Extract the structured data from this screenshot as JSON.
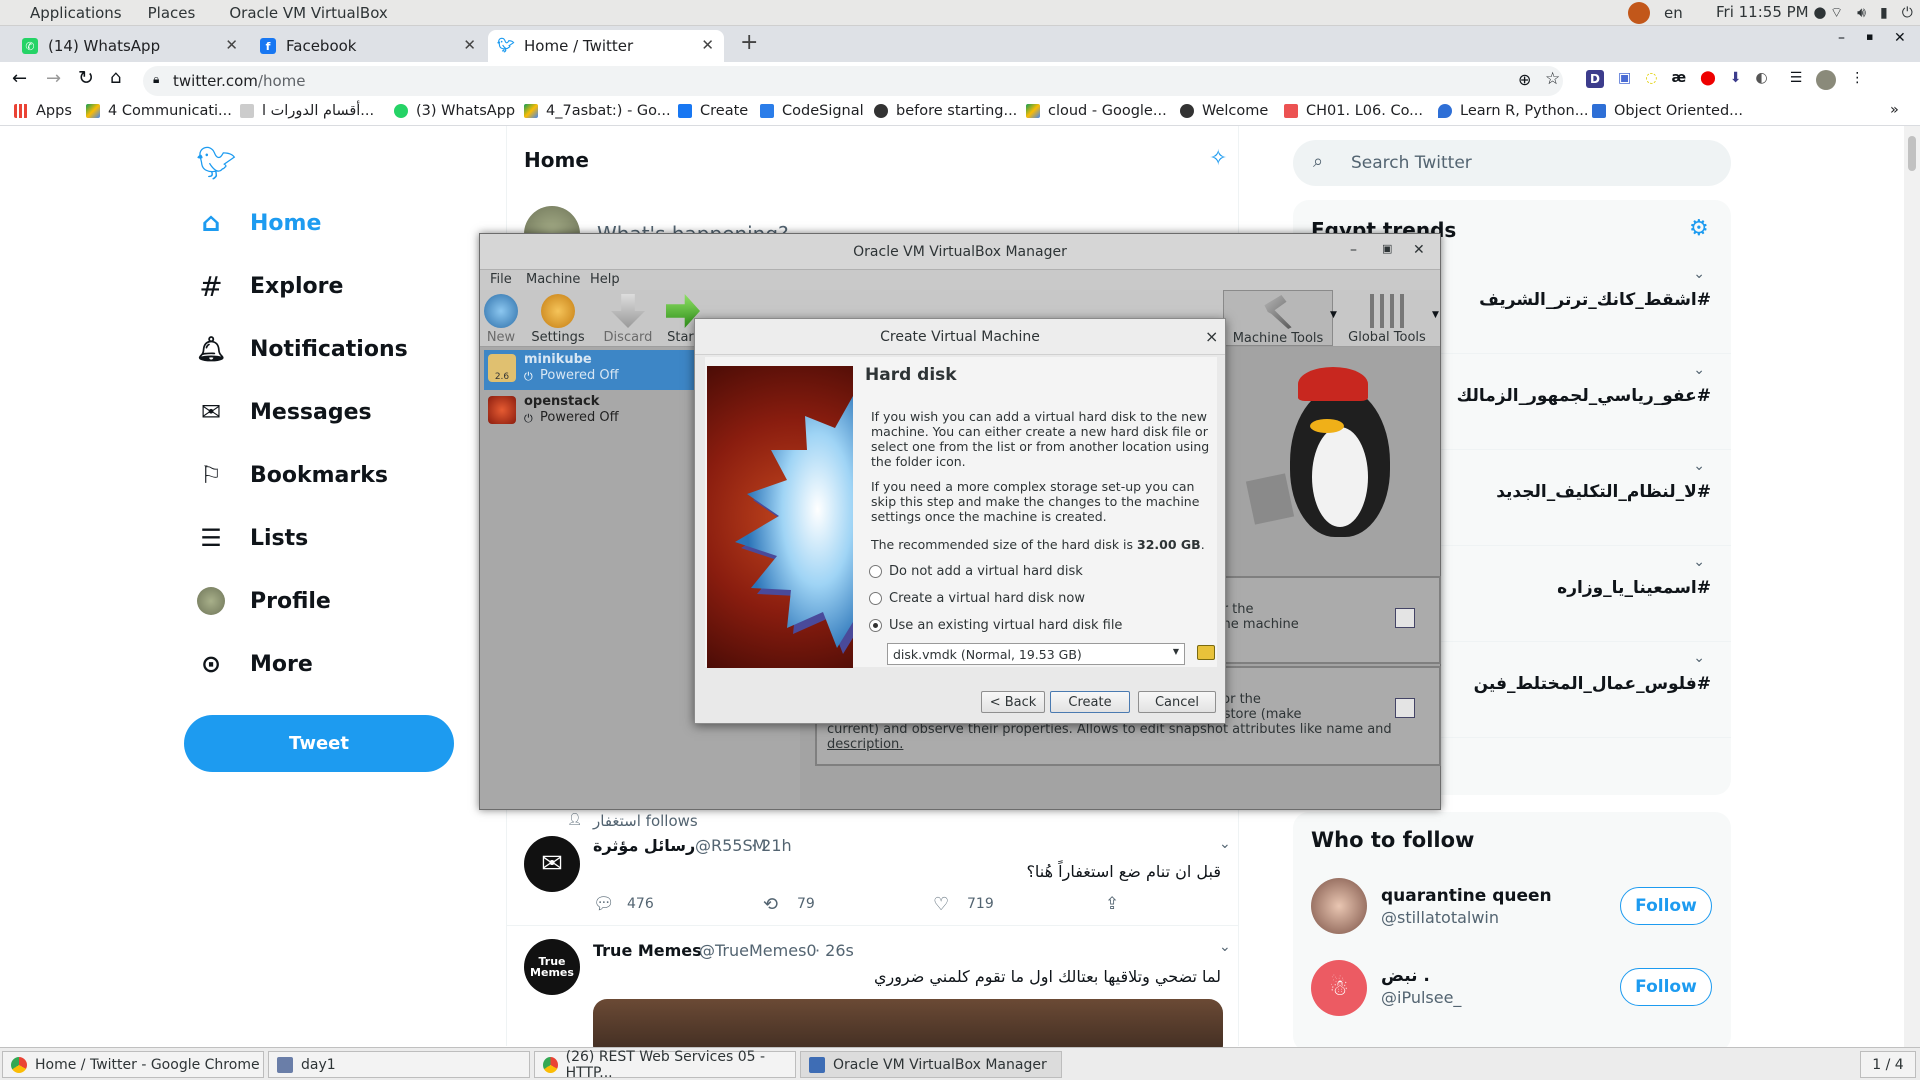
{
  "system_panel": {
    "applications": "Applications",
    "places": "Places",
    "app_name": "Oracle VM VirtualBox",
    "lang": "en",
    "clock": "Fri 11:55 PM ●"
  },
  "browser": {
    "tabs": [
      {
        "label": "(14) WhatsApp"
      },
      {
        "label": "Facebook"
      },
      {
        "label": "Home / Twitter"
      }
    ],
    "url_host": "twitter.com",
    "url_path": "/home",
    "bookmarks": [
      "Apps",
      "4 Communicati...",
      "أقسام الدورات ا...",
      "(3) WhatsApp",
      "4_7asbat:) - Go...",
      "Create",
      "CodeSignal",
      "before starting...",
      "cloud - Google...",
      "Welcome",
      "CH01. L06. Co...",
      "Learn R, Python...",
      "Object Oriented..."
    ],
    "ext_labels": [
      "D",
      "æ"
    ],
    "more": "»"
  },
  "twitter": {
    "nav": [
      {
        "label": "Home"
      },
      {
        "label": "Explore"
      },
      {
        "label": "Notifications"
      },
      {
        "label": "Messages"
      },
      {
        "label": "Bookmarks"
      },
      {
        "label": "Lists"
      },
      {
        "label": "Profile"
      },
      {
        "label": "More"
      }
    ],
    "tweet_button": "Tweet",
    "header": "Home",
    "compose_placeholder": "What's happening?",
    "search_placeholder": "Search Twitter",
    "trends_title": "Egypt trends",
    "trends": [
      "#اشقط_كانك_ترتر_الشريف",
      "#عفو_رياسي_لجمهور_الزمالك",
      "#لا_لنظام_التكليف_الجديد",
      "#اسمعينا_يا_وزاره",
      "#فلوس_عمال_المختلط_فين"
    ],
    "who_to_follow": "Who to follow",
    "follow_suggestions": [
      {
        "name": "quarantine queen",
        "handle": "@stillatotalwin",
        "button": "Follow"
      },
      {
        "name": "نبض .",
        "handle": "@iPulsee_",
        "button": "Follow"
      }
    ],
    "tweets": [
      {
        "context": "استغفار follows",
        "name": "رسائل مؤثرة",
        "handle": "@R55SM",
        "time": "· 21h",
        "text": "قبل ان تنام ضع استغفاراً هُنا؟",
        "replies": "476",
        "retweets": "79",
        "likes": "719"
      },
      {
        "name": "True Memes",
        "handle": "@TrueMemes0",
        "time": "· 26s",
        "text": "لما تضحي وتلاقيها بعتالك اول ما تقوم كلمني ضروري",
        "avatar_text": "True Memes"
      }
    ]
  },
  "virtualbox": {
    "title": "Oracle VM VirtualBox Manager",
    "menu": [
      "File",
      "Machine",
      "Help"
    ],
    "tools": [
      {
        "label": "New"
      },
      {
        "label": "Settings"
      },
      {
        "label": "Discard"
      },
      {
        "label": "Start"
      }
    ],
    "right_tools": [
      {
        "label": "Machine Tools"
      },
      {
        "label": "Global Tools"
      }
    ],
    "vms": [
      {
        "name": "minikube",
        "state": "Powered Off",
        "badge": "2.6"
      },
      {
        "name": "openstack",
        "state": "Powered Off"
      }
    ],
    "cards": [
      {
        "lines": [
          "operties for the",
          "rties (like the machine"
        ]
      },
      {
        "lines": [
          "s created for the",
          "remove, restore (make",
          "current) and observe their properties. Allows to edit snapshot attributes like name and",
          "description."
        ]
      }
    ]
  },
  "dialog": {
    "title": "Create Virtual Machine",
    "close": "×",
    "heading": "Hard disk",
    "para1": "If you wish you can add a virtual hard disk to the new machine. You can either create a new hard disk file or select one from the list or from another location using the folder icon.",
    "para2": "If you need a more complex storage set-up you can skip this step and make the changes to the machine settings once the machine is created.",
    "recommend_prefix": "The recommended size of the hard disk is ",
    "recommend_size": "32.00 GB",
    "recommend_suffix": ".",
    "options": [
      "Do not add a virtual hard disk",
      "Create a virtual hard disk now",
      "Use an existing virtual hard disk file"
    ],
    "selected_option": 2,
    "disk_select": "disk.vmdk (Normal, 19.53 GB)",
    "buttons": {
      "back": "< Back",
      "create": "Create",
      "cancel": "Cancel"
    }
  },
  "taskbar": {
    "items": [
      "Home / Twitter - Google Chrome",
      "day1",
      "(26) REST Web Services 05 - HTTP...",
      "Oracle VM VirtualBox Manager"
    ],
    "workspace": "1 / 4"
  },
  "colors": {
    "twitter_blue": "#1d9bf0",
    "vbox_selected": "#3d86c6"
  }
}
